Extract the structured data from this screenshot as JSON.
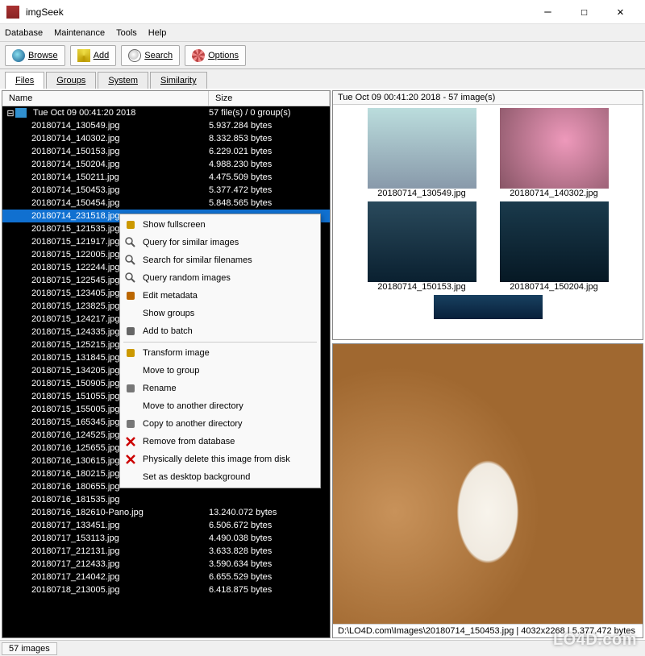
{
  "window": {
    "title": "imgSeek"
  },
  "menu": {
    "items": [
      "Database",
      "Maintenance",
      "Tools",
      "Help"
    ]
  },
  "toolbar": {
    "browse": "Browse",
    "add": "Add",
    "search": "Search",
    "options": "Options"
  },
  "tabs": {
    "items": [
      "Files",
      "Groups",
      "System",
      "Similarity"
    ],
    "active": 0
  },
  "tree": {
    "headers": {
      "name": "Name",
      "size": "Size"
    },
    "root": {
      "label": "Tue Oct 09 00:41:20 2018",
      "summary": "57 file(s) / 0 group(s)"
    },
    "rows": [
      {
        "name": "20180714_130549.jpg",
        "size": "5.937.284 bytes"
      },
      {
        "name": "20180714_140302.jpg",
        "size": "8.332.853 bytes"
      },
      {
        "name": "20180714_150153.jpg",
        "size": "6.229.021 bytes"
      },
      {
        "name": "20180714_150204.jpg",
        "size": "4.988.230 bytes"
      },
      {
        "name": "20180714_150211.jpg",
        "size": "4.475.509 bytes"
      },
      {
        "name": "20180714_150453.jpg",
        "size": "5.377.472 bytes"
      },
      {
        "name": "20180714_150454.jpg",
        "size": "5.848.565 bytes"
      },
      {
        "name": "20180714_231518.jpg",
        "size": "",
        "selected": true
      },
      {
        "name": "20180715_121535.jpg",
        "size": ""
      },
      {
        "name": "20180715_121917.jpg",
        "size": ""
      },
      {
        "name": "20180715_122005.jpg",
        "size": ""
      },
      {
        "name": "20180715_122244.jpg",
        "size": ""
      },
      {
        "name": "20180715_122545.jpg",
        "size": ""
      },
      {
        "name": "20180715_123405.jpg",
        "size": ""
      },
      {
        "name": "20180715_123825.jpg",
        "size": ""
      },
      {
        "name": "20180715_124217.jpg",
        "size": ""
      },
      {
        "name": "20180715_124335.jpg",
        "size": ""
      },
      {
        "name": "20180715_125215.jpg",
        "size": ""
      },
      {
        "name": "20180715_131845.jpg",
        "size": ""
      },
      {
        "name": "20180715_134205.jpg",
        "size": ""
      },
      {
        "name": "20180715_150905.jpg",
        "size": ""
      },
      {
        "name": "20180715_151055.jpg",
        "size": ""
      },
      {
        "name": "20180715_155005.jpg",
        "size": ""
      },
      {
        "name": "20180715_165345.jpg",
        "size": ""
      },
      {
        "name": "20180716_124525.jpg",
        "size": ""
      },
      {
        "name": "20180716_125655.jpg",
        "size": ""
      },
      {
        "name": "20180716_130615.jpg",
        "size": ""
      },
      {
        "name": "20180716_180215.jpg",
        "size": ""
      },
      {
        "name": "20180716_180655.jpg",
        "size": ""
      },
      {
        "name": "20180716_181535.jpg",
        "size": ""
      },
      {
        "name": "20180716_182610-Pano.jpg",
        "size": "13.240.072 bytes"
      },
      {
        "name": "20180717_133451.jpg",
        "size": "6.506.672 bytes"
      },
      {
        "name": "20180717_153113.jpg",
        "size": "4.490.038 bytes"
      },
      {
        "name": "20180717_212131.jpg",
        "size": "3.633.828 bytes"
      },
      {
        "name": "20180717_212433.jpg",
        "size": "3.590.634 bytes"
      },
      {
        "name": "20180717_214042.jpg",
        "size": "6.655.529 bytes"
      },
      {
        "name": "20180718_213005.jpg",
        "size": "6.418.875 bytes"
      }
    ]
  },
  "thumbs": {
    "header": "Tue Oct 09 00:41:20 2018 - 57 image(s)",
    "items": [
      {
        "name": "20180714_130549.jpg"
      },
      {
        "name": "20180714_140302.jpg"
      },
      {
        "name": "20180714_150153.jpg"
      },
      {
        "name": "20180714_150204.jpg"
      }
    ]
  },
  "preview": {
    "status": "D:\\LO4D.com\\Images\\20180714_150453.jpg | 4032x2268 | 5.377.472 bytes"
  },
  "statusbar": {
    "text": "57 images"
  },
  "context_menu": {
    "items": [
      {
        "label": "Show fullscreen",
        "icon": "fullscreen"
      },
      {
        "label": "Query for similar images",
        "icon": "magnify"
      },
      {
        "label": "Search for similar filenames",
        "icon": "magnify"
      },
      {
        "label": "Query random images",
        "icon": "magnify"
      },
      {
        "label": "Edit metadata",
        "icon": "edit"
      },
      {
        "label": "Show groups",
        "icon": ""
      },
      {
        "label": "Add to batch",
        "icon": "gear"
      },
      {
        "sep": true
      },
      {
        "label": "Transform image",
        "icon": "person"
      },
      {
        "label": "Move to group",
        "icon": ""
      },
      {
        "label": "Rename",
        "icon": "disk"
      },
      {
        "label": "Move to another directory",
        "icon": ""
      },
      {
        "label": "Copy to another directory",
        "icon": "disk"
      },
      {
        "label": "Remove from database",
        "icon": "x-red"
      },
      {
        "label": "Physically delete this image from disk",
        "icon": "x-red"
      },
      {
        "label": "Set as desktop background",
        "icon": ""
      }
    ]
  },
  "watermark": "LO4D.com"
}
